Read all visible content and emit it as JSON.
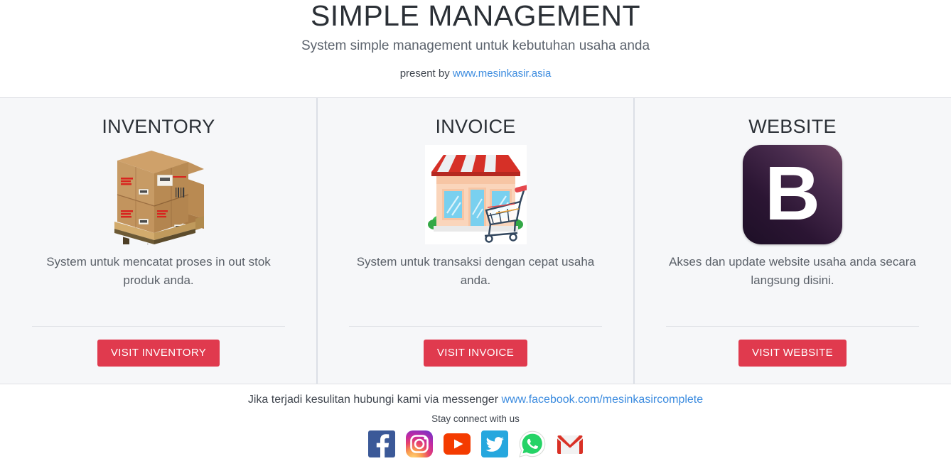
{
  "header": {
    "title": "SIMPLE MANAGEMENT",
    "subtitle": "System simple management untuk kebutuhan usaha anda",
    "present_prefix": "present by ",
    "present_link": "www.mesinkasir.asia"
  },
  "cards": [
    {
      "title": "INVENTORY",
      "image": "cardboard-boxes-on-pallet-image",
      "description": "System untuk mencatat proses in out stok produk anda.",
      "button_label": "VISIT INVENTORY"
    },
    {
      "title": "INVOICE",
      "image": "storefront-with-shopping-cart-image",
      "description": "System untuk transaksi dengan cepat usaha anda.",
      "button_label": "VISIT INVOICE"
    },
    {
      "title": "WEBSITE",
      "image": "bootstrap-logo-image",
      "logo_letter": "B",
      "description": "Akses dan update website usaha anda secara langsung disini.",
      "button_label": "VISIT WEBSITE"
    }
  ],
  "footer": {
    "contact_prefix": "Jika terjadi kesulitan hubungi kami via messenger ",
    "contact_link": "www.facebook.com/mesinkasircomplete",
    "stay_connect": "Stay connect with us",
    "social": [
      {
        "name": "facebook-icon",
        "color": "#3b5998"
      },
      {
        "name": "instagram-icon",
        "color": "#e1306c"
      },
      {
        "name": "youtube-icon",
        "color": "#f43b00"
      },
      {
        "name": "twitter-icon",
        "color": "#26a7de"
      },
      {
        "name": "whatsapp-icon",
        "color": "#25d366"
      },
      {
        "name": "gmail-icon",
        "color": "#d93025"
      }
    ]
  },
  "colors": {
    "button": "#e03a4e",
    "link": "#3b8bdf",
    "section_bg": "#f6f7f9"
  }
}
